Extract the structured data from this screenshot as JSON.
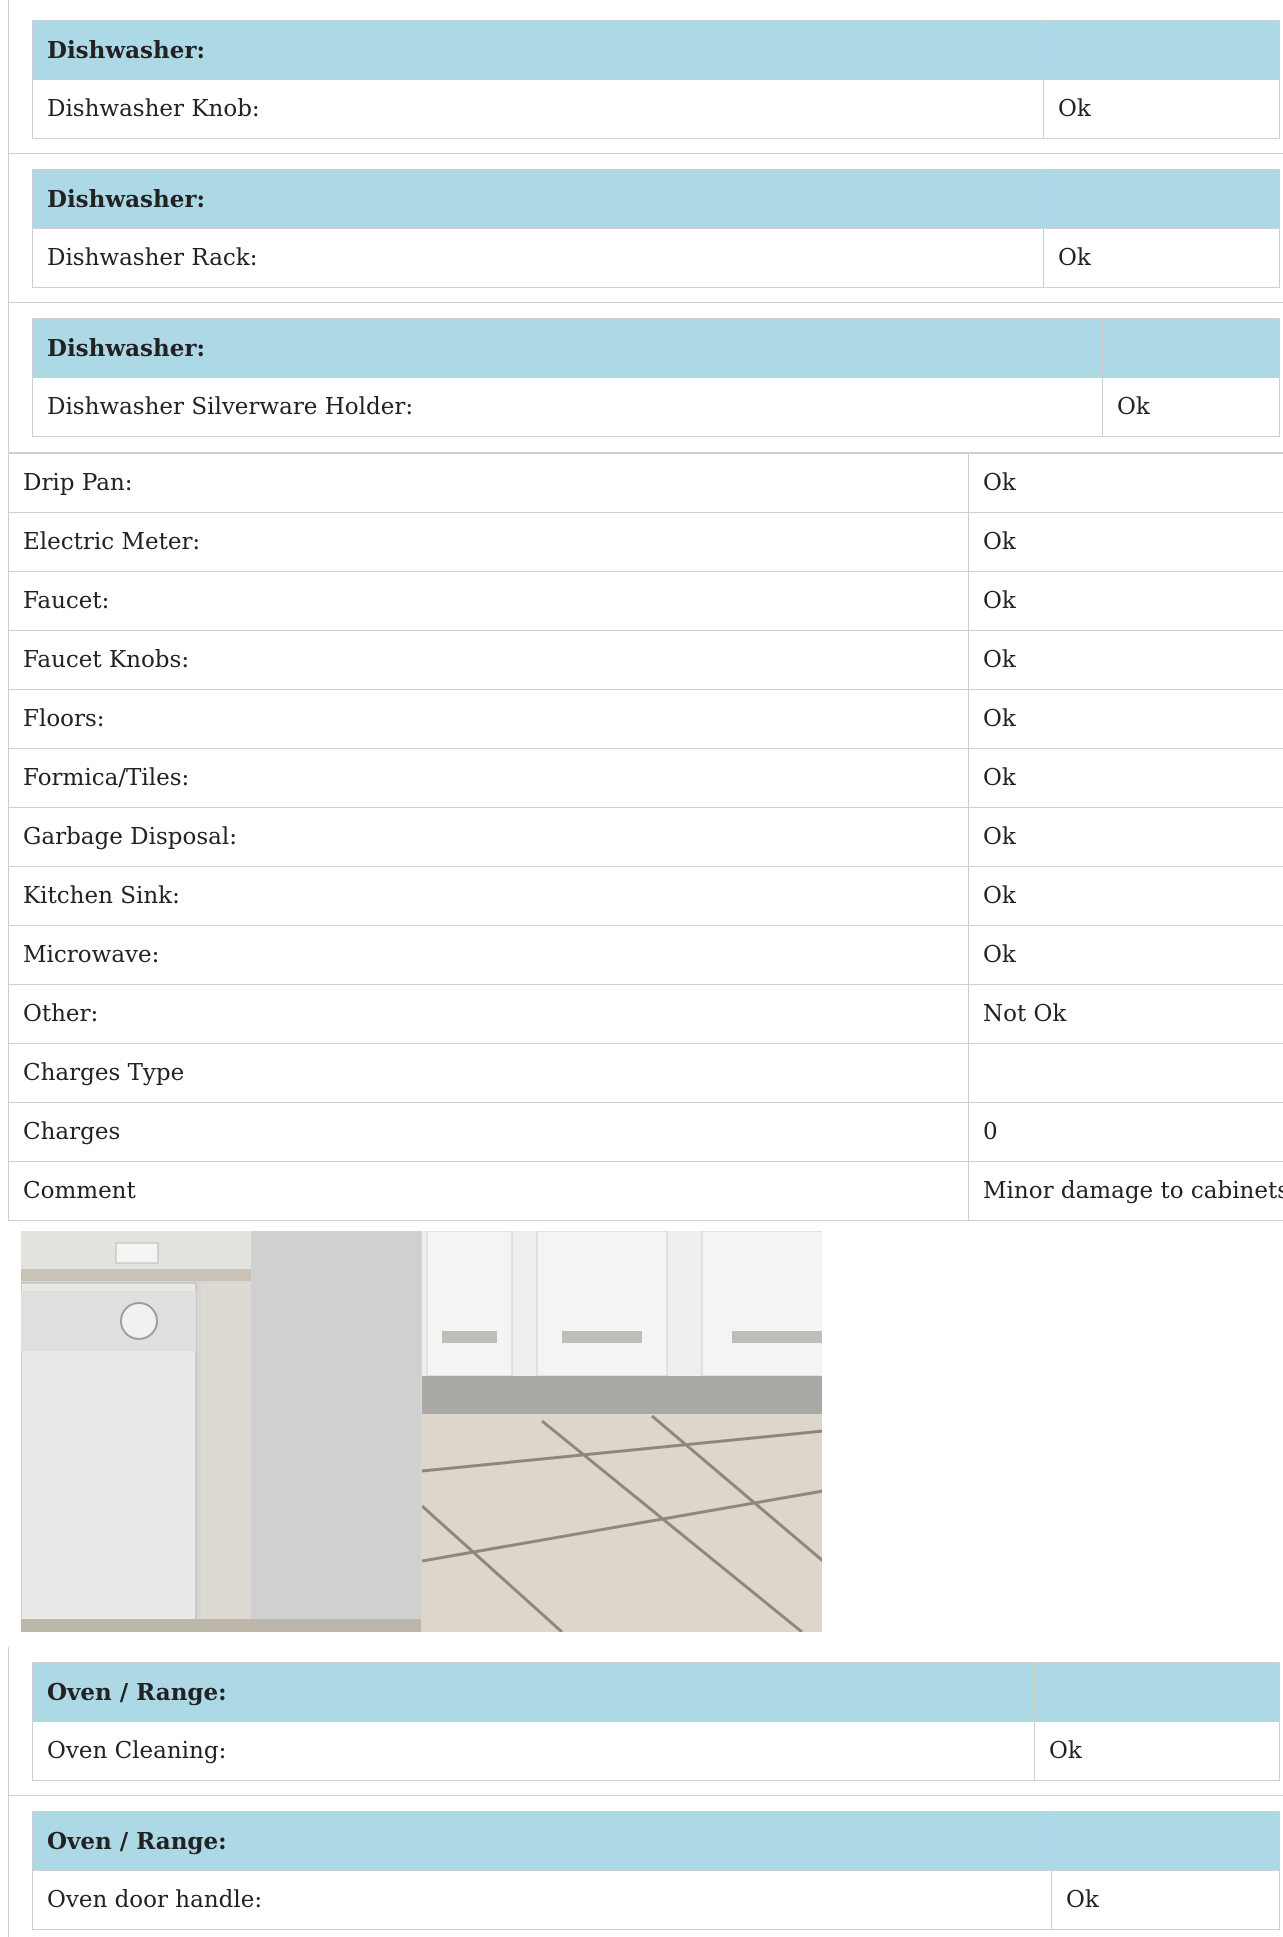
{
  "sections": [
    {
      "header": "Dishwasher:",
      "label": "Dishwasher Knob:",
      "value": "Ok"
    },
    {
      "header": "Dishwasher:",
      "label": "Dishwasher Rack:",
      "value": "Ok"
    },
    {
      "header": "Dishwasher:",
      "label": "Dishwasher Silverware Holder:",
      "value": "Ok"
    }
  ],
  "rows": [
    {
      "label": "Drip Pan:",
      "value": "Ok"
    },
    {
      "label": "Electric Meter:",
      "value": "Ok"
    },
    {
      "label": "Faucet:",
      "value": "Ok"
    },
    {
      "label": "Faucet Knobs:",
      "value": "Ok"
    },
    {
      "label": "Floors:",
      "value": "Ok"
    },
    {
      "label": "Formica/Tiles:",
      "value": "Ok"
    },
    {
      "label": "Garbage Disposal:",
      "value": "Ok"
    },
    {
      "label": "Kitchen Sink:",
      "value": "Ok"
    },
    {
      "label": "Microwave:",
      "value": "Ok"
    },
    {
      "label": "Other:",
      "value": "Not Ok"
    },
    {
      "label": "Charges Type",
      "value": ""
    },
    {
      "label": "Charges",
      "value": "0"
    },
    {
      "label": "Comment",
      "value": "Minor damage to cabinets"
    }
  ],
  "oven_sections": [
    {
      "header": "Oven / Range:",
      "label": "Oven Cleaning:",
      "value": "Ok"
    },
    {
      "header": "Oven / Range:",
      "label": "Oven door handle:",
      "value": "Ok"
    }
  ],
  "colors": {
    "header_bg": "#add8e6",
    "border": "#cfcfcf"
  },
  "photos": [
    "dishwasher-photo",
    "cabinet-floor-photo"
  ]
}
